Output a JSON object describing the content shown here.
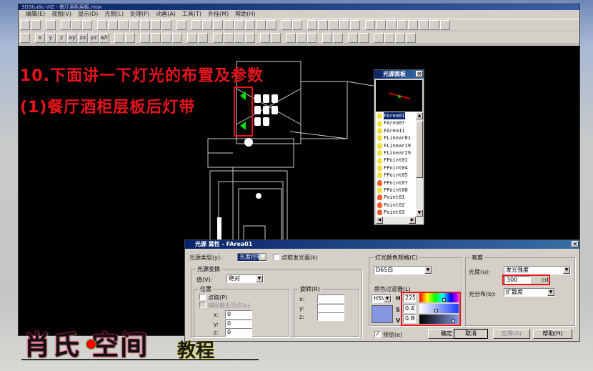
{
  "app": {
    "title": "3DStudio VIZ - 餐厅酒柜层板.max",
    "menu": [
      "编辑(E)",
      "视图(V)",
      "显示(D)",
      "光照(L)",
      "处理(P)",
      "动画(A)",
      "工具(T)",
      "外挂(M)",
      "帮助(H)"
    ]
  },
  "toolbar1": [
    "open-icon",
    "save-icon",
    "sep",
    "undo-icon",
    "sep",
    "print-icon",
    "help-icon",
    "context-help-icon",
    "sep",
    "camera-icon",
    "view-box-1-icon",
    "view-box-2-icon",
    "view-box-3-icon",
    "view-box-4-icon",
    "view-box-5-icon",
    "view-box-6-icon",
    "sep",
    "zoom-region-icon",
    "sep",
    "orbit-icon",
    "pan-view-icon",
    "zoom-in-icon",
    "zoom-icon",
    "move-icon",
    "walk-icon",
    "dolly-icon",
    "rotate-icon",
    "sep",
    "zoom-extents-icon",
    "render-view-icon",
    "sep",
    "light-off-icon",
    "light-wire-icon",
    "box-icon",
    "green-box-icon",
    "green-cube-icon",
    "sep",
    "layer-1-icon",
    "layer-2-icon",
    "layer-3-icon",
    "hatch-icon",
    "blank-icon",
    "globe-icon",
    "frame-icon",
    "camera2-icon"
  ],
  "toolbar2": [
    "axis-icon",
    "sep",
    "x",
    "y",
    "z",
    "xy",
    "zx",
    "yz",
    "a/r",
    "sep",
    "magnet-1-icon",
    "magnet-2-icon",
    "sep",
    "layers-icon",
    "refresh-icon",
    "copy-icon",
    "undo-select-icon",
    "sep",
    "select-icon",
    "select-help-icon",
    "sep",
    "select-window-icon",
    "select-cross-icon",
    "select-3-icon",
    "select-4-icon",
    "sep",
    "doc-select-icon",
    "doc-icon",
    "sep",
    "doc-select-2-icon",
    "doc-select-3-icon",
    "arc-select-icon",
    "sep",
    "list-select-icon",
    "filter-select-icon",
    "sep",
    "add-select-icon",
    "group-select-icon",
    "sep",
    "walk-person-icon",
    "gray-1-icon",
    "gray-2-icon",
    "gray-3-icon"
  ],
  "overlay": {
    "line1": "10.下面讲一下灯光的布置及参数",
    "line2": "(1)餐厅酒柜层板后灯带"
  },
  "light_panel": {
    "title": "光源面板",
    "items": [
      {
        "name": "FArea01",
        "color": "#f0e040",
        "selected": true
      },
      {
        "name": "FArea07",
        "color": "#f0e040"
      },
      {
        "name": "FArea11",
        "color": "#f0e040"
      },
      {
        "name": "FLinear01",
        "color": "#f0e040"
      },
      {
        "name": "FLinear19",
        "color": "#f0e040"
      },
      {
        "name": "FLinear29",
        "color": "#f0e040"
      },
      {
        "name": "FPoint01",
        "color": "#f0e040"
      },
      {
        "name": "FPoint04",
        "color": "#f0e040"
      },
      {
        "name": "FPoint05",
        "color": "#f0e040"
      },
      {
        "name": "FPoint07",
        "color": "#f06030"
      },
      {
        "name": "FPoint08",
        "color": "#f0e040"
      },
      {
        "name": "Point01",
        "color": "#f06030"
      },
      {
        "name": "Point02",
        "color": "#f06030"
      },
      {
        "name": "Point03",
        "color": "#f06030"
      },
      {
        "name": "Point04",
        "color": "#f06030"
      }
    ]
  },
  "dialog": {
    "title": "光源 属性 - FArea01",
    "light_type_label": "光源类型(y):",
    "light_type_value": "光度控制",
    "pick_surface_label": "点取发光面(k)",
    "transform_group": "光源变换",
    "value_label": "值(V):",
    "value_select": "绝对",
    "position_group": "位置",
    "pick_label": "点取(P)",
    "snap_label": "捕捉最近顶点(s)",
    "pos": {
      "x_label": "x:",
      "y_label": "y:",
      "z_label": "z:",
      "x": "0",
      "y": "0",
      "z": "0"
    },
    "rotation_group": "旋转(R)",
    "rot": {
      "x_label": "x:",
      "y_label": "y:",
      "z_label": "z:"
    },
    "color_spec_group": "灯光颜色规格(C)",
    "color_spec_value": "D65白",
    "filter_label": "颜色过滤器(L)",
    "model": "HSV",
    "h_label": "H",
    "s_label": "S",
    "v_label": "V",
    "h": "225.",
    "s": "0.42",
    "v": "0.89",
    "h_fraction": 0.63,
    "s_fraction": 0.42,
    "v_fraction": 0.89,
    "swatch_color": "#8496e0",
    "brightness_group": "亮度",
    "luminosity_label": "光度(u):",
    "luminosity_value": "发光强度",
    "intensity": "300",
    "intensity_unit": "cd",
    "distribution_label": "光分布(b):",
    "distribution_value": "扩散度",
    "preview_label": "预览(e)",
    "preview_checked": true,
    "ok": "确定",
    "cancel": "取消",
    "apply": "应用(A)",
    "help": "帮助(H)"
  },
  "logo": {
    "main": "肖氏 空间",
    "sub": "教程"
  }
}
